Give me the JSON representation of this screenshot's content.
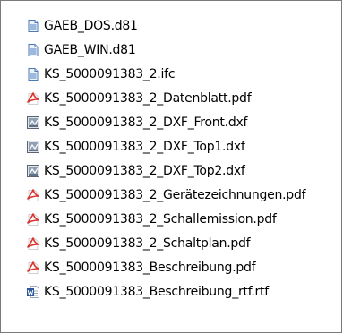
{
  "files": [
    {
      "name": "GAEB_DOS.d81",
      "icon": "generic-file-icon"
    },
    {
      "name": "GAEB_WIN.d81",
      "icon": "generic-file-icon"
    },
    {
      "name": "KS_5000091383_2.ifc",
      "icon": "generic-file-icon"
    },
    {
      "name": "KS_5000091383_2_Datenblatt.pdf",
      "icon": "pdf-file-icon"
    },
    {
      "name": "KS_5000091383_2_DXF_Front.dxf",
      "icon": "dxf-file-icon"
    },
    {
      "name": "KS_5000091383_2_DXF_Top1.dxf",
      "icon": "dxf-file-icon"
    },
    {
      "name": "KS_5000091383_2_DXF_Top2.dxf",
      "icon": "dxf-file-icon"
    },
    {
      "name": "KS_5000091383_2_Gerätezeichnungen.pdf",
      "icon": "pdf-file-icon"
    },
    {
      "name": "KS_5000091383_2_Schallemission.pdf",
      "icon": "pdf-file-icon"
    },
    {
      "name": "KS_5000091383_2_Schaltplan.pdf",
      "icon": "pdf-file-icon"
    },
    {
      "name": "KS_5000091383_Beschreibung.pdf",
      "icon": "pdf-file-icon"
    },
    {
      "name": "KS_5000091383_Beschreibung_rtf.rtf",
      "icon": "word-file-icon"
    }
  ],
  "colors": {
    "panel_border": "#7a7a7a",
    "pdf_red": "#d8322a",
    "generic_blue": "#4a7ab8",
    "word_blue": "#2b579a",
    "dxf_frame": "#5a6470"
  }
}
